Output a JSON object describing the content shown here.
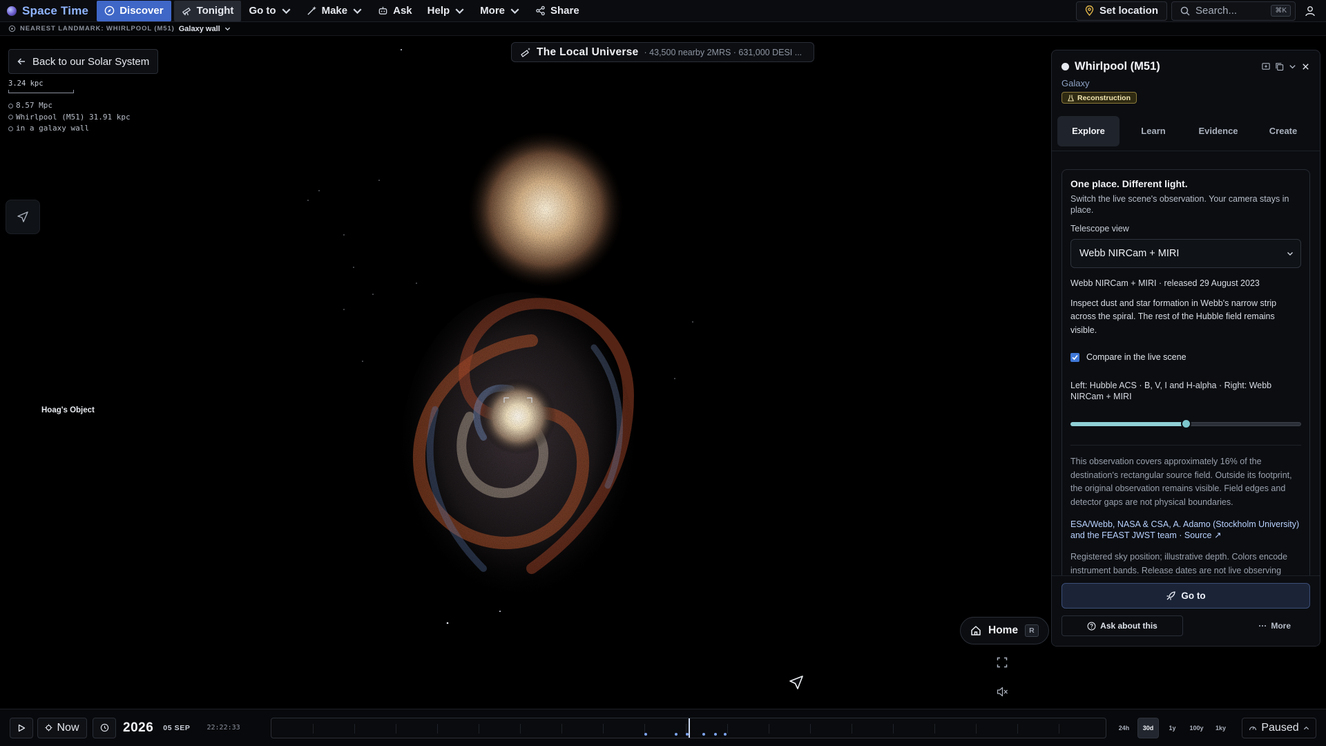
{
  "app": {
    "name": "Space Time",
    "accent": "#3f67c7"
  },
  "nav": {
    "discover": "Discover",
    "tonight": "Tonight",
    "go_to": "Go to",
    "make": "Make",
    "ask": "Ask",
    "help": "Help",
    "more": "More",
    "share": "Share",
    "set_location": "Set location",
    "search_placeholder": "Search...",
    "search_shortcut": "⌘K"
  },
  "landmark": {
    "label": "NEAREST LANDMARK: WHIRLPOOL (M51)",
    "value": "Galaxy wall"
  },
  "scene": {
    "back_button": "Back to our Solar System",
    "scale_value": "3.24 kpc",
    "distances": [
      "8.57 Mpc",
      "Whirlpool (M51) 31.91 kpc",
      "in a galaxy wall"
    ],
    "hoag_label": "Hoag's Object",
    "universe_title": "The Local Universe",
    "universe_subtitle": "· 43,500 nearby 2MRS · 631,000 DESI ...",
    "home_label": "Home",
    "home_shortcut": "R"
  },
  "panel": {
    "title": "Whirlpool (M51)",
    "type": "Galaxy",
    "badge": "Reconstruction",
    "tabs": [
      "Explore",
      "Learn",
      "Evidence",
      "Create"
    ],
    "active_tab": 0,
    "card": {
      "title": "One place. Different light.",
      "subtitle": "Switch the live scene's observation. Your camera stays in place.",
      "telescope_label": "Telescope view",
      "telescope_value": "Webb NIRCam + MIRI",
      "release": "Webb NIRCam + MIRI · released 29 August 2023",
      "description": "Inspect dust and star formation in Webb's narrow strip across the spiral. The rest of the Hubble field remains visible.",
      "compare_label": "Compare in the live scene",
      "compare_checked": true,
      "compare_text": "Left: Hubble ACS · B, V, I and H-alpha · Right: Webb NIRCam + MIRI",
      "slider_fraction": 0.5,
      "coverage_note": "This observation covers approximately 16% of the destination's rectangular source field. Outside its footprint, the original observation remains visible. Field edges and detector gaps are not physical boundaries.",
      "credit": "ESA/Webb, NASA & CSA, A. Adamo (Stockholm University) and the FEAST JWST team · Source ↗",
      "registered": "Registered sky position; illustrative depth. Colors encode instrument bands. Release dates are not live observing"
    },
    "go_to": "Go to",
    "ask_about": "Ask about this",
    "more": "More"
  },
  "timeline": {
    "now": "Now",
    "year": "2026",
    "date": "05 SEP",
    "time": "22:22:33",
    "ranges": [
      "24h",
      "30d",
      "1y",
      "100y",
      "1ky"
    ],
    "active_range": 1,
    "status": "Paused"
  }
}
